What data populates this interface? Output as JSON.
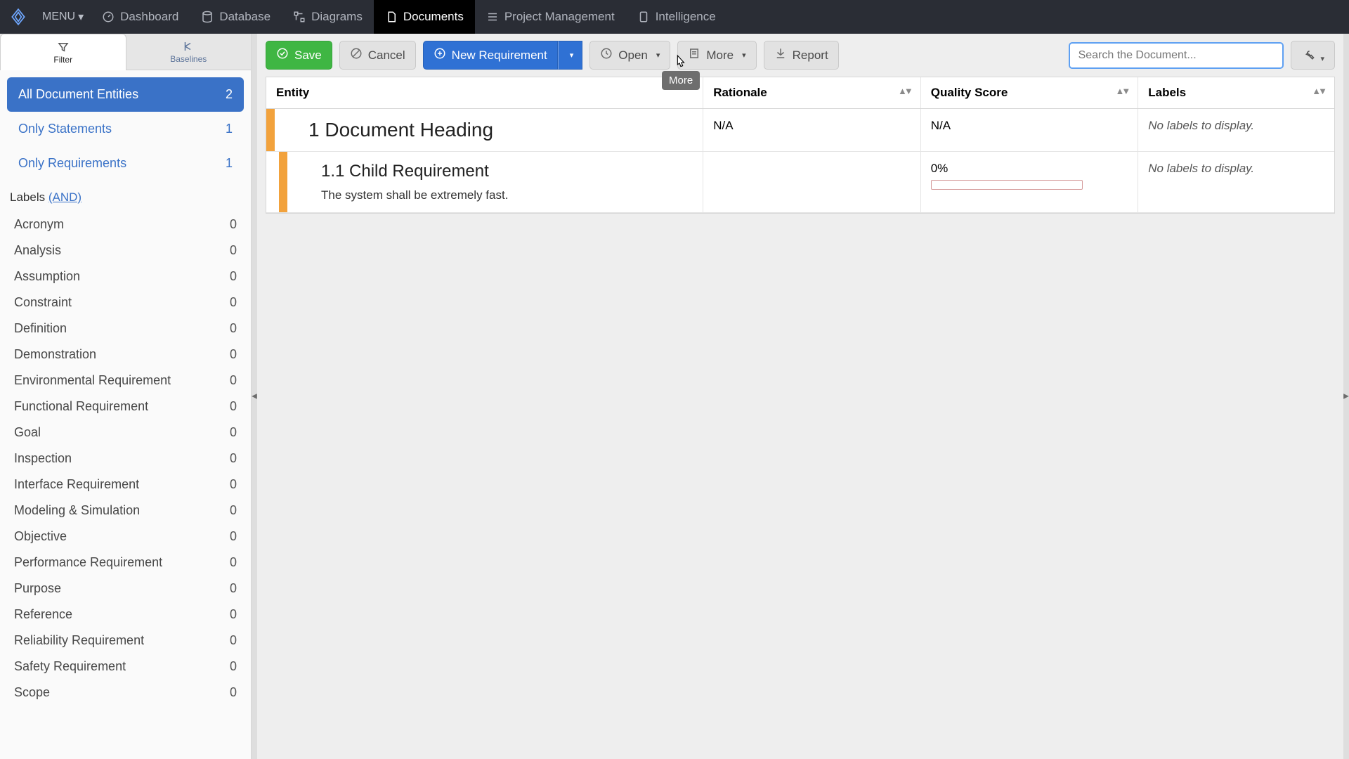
{
  "nav": {
    "menu": "MENU",
    "items": [
      {
        "label": "Dashboard"
      },
      {
        "label": "Database"
      },
      {
        "label": "Diagrams"
      },
      {
        "label": "Documents"
      },
      {
        "label": "Project Management"
      },
      {
        "label": "Intelligence"
      }
    ],
    "active_index": 3
  },
  "sidebar": {
    "tabs": {
      "filter": "Filter",
      "baselines": "Baselines"
    },
    "filters": {
      "all": {
        "label": "All Document Entities",
        "count": "2"
      },
      "statements": {
        "label": "Only Statements",
        "count": "1"
      },
      "requirements": {
        "label": "Only Requirements",
        "count": "1"
      }
    },
    "labels_header": "Labels",
    "labels_mode": "(AND)",
    "labels": [
      {
        "name": "Acronym",
        "count": "0"
      },
      {
        "name": "Analysis",
        "count": "0"
      },
      {
        "name": "Assumption",
        "count": "0"
      },
      {
        "name": "Constraint",
        "count": "0"
      },
      {
        "name": "Definition",
        "count": "0"
      },
      {
        "name": "Demonstration",
        "count": "0"
      },
      {
        "name": "Environmental Requirement",
        "count": "0"
      },
      {
        "name": "Functional Requirement",
        "count": "0"
      },
      {
        "name": "Goal",
        "count": "0"
      },
      {
        "name": "Inspection",
        "count": "0"
      },
      {
        "name": "Interface Requirement",
        "count": "0"
      },
      {
        "name": "Modeling & Simulation",
        "count": "0"
      },
      {
        "name": "Objective",
        "count": "0"
      },
      {
        "name": "Performance Requirement",
        "count": "0"
      },
      {
        "name": "Purpose",
        "count": "0"
      },
      {
        "name": "Reference",
        "count": "0"
      },
      {
        "name": "Reliability Requirement",
        "count": "0"
      },
      {
        "name": "Safety Requirement",
        "count": "0"
      },
      {
        "name": "Scope",
        "count": "0"
      }
    ]
  },
  "toolbar": {
    "save": "Save",
    "cancel": "Cancel",
    "new_requirement": "New Requirement",
    "open": "Open",
    "more": "More",
    "report": "Report",
    "search_placeholder": "Search the Document...",
    "tooltip_more": "More"
  },
  "table": {
    "columns": {
      "entity": "Entity",
      "rationale": "Rationale",
      "quality": "Quality Score",
      "labels": "Labels"
    },
    "rows": [
      {
        "title": "1 Document Heading",
        "body": "",
        "rationale": "N/A",
        "quality": "N/A",
        "labels": "No labels to display.",
        "child": false
      },
      {
        "title": "1.1 Child Requirement",
        "body": "The system shall be extremely fast.",
        "rationale": "",
        "quality": "0%",
        "labels": "No labels to display.",
        "child": true
      }
    ]
  }
}
